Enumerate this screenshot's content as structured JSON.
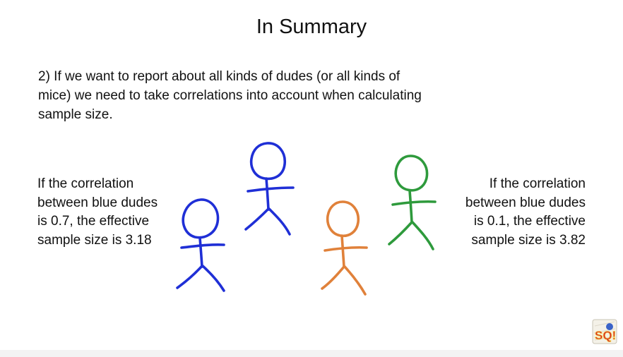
{
  "slide": {
    "title": "In Summary",
    "point_lines": [
      "2) If we want to report about all kinds of dudes (or all kinds of",
      "mice) we need to take correlations into account when calculating",
      "sample size."
    ],
    "left_note_lines": [
      "If the correlation",
      "between blue dudes",
      "is 0.7, the effective",
      "sample size is 3.18"
    ],
    "right_note_lines": [
      "If the correlation",
      "between blue dudes",
      "is 0.1, the effective",
      "sample size is 3.82"
    ]
  },
  "figures": [
    {
      "name": "blue-dude-left",
      "color": "#1f2fd6"
    },
    {
      "name": "blue-dude-top",
      "color": "#1f2fd6"
    },
    {
      "name": "orange-dude",
      "color": "#e0813a"
    },
    {
      "name": "green-dude",
      "color": "#2e9a3c"
    }
  ],
  "logo": {
    "text": "SQ!",
    "icon": "statquest-logo-icon",
    "colors": [
      "#d8262e",
      "#f2d23c",
      "#3a63c8"
    ]
  }
}
